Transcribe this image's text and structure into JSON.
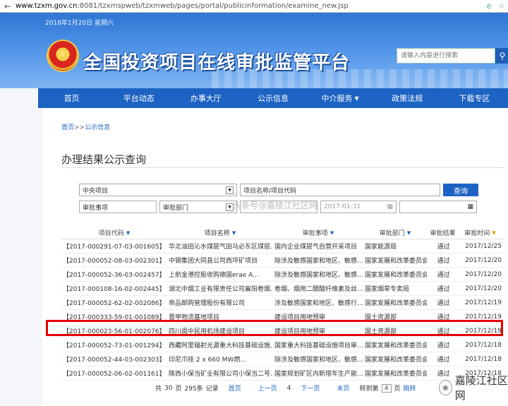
{
  "browser": {
    "url_host": "www.tzxm.gov.cn",
    "url_rest": ":8081/tzxmspweb/tzxmweb/pages/portal/publicinformation/examine_new.jsp"
  },
  "header": {
    "date": "2018年1月20日 星期六",
    "title": "全国投资项目在线审批监管平台",
    "search_placeholder": "请输入内容进行搜索"
  },
  "nav": {
    "items": [
      {
        "label": "首页"
      },
      {
        "label": "平台动态"
      },
      {
        "label": "办事大厅"
      },
      {
        "label": "公示信息"
      },
      {
        "label": "中介服务",
        "caret": "▼"
      },
      {
        "label": "政策法规"
      },
      {
        "label": "下载专区"
      }
    ]
  },
  "breadcrumb": {
    "home": "首页",
    "sep": ">>",
    "current": "公示信息"
  },
  "section": {
    "title": "办理结果公示查询"
  },
  "filters": {
    "dept_select": "中央项目",
    "project_input": "项目名称/项目代码",
    "query_label": "查询",
    "matter_select": "审批事项",
    "dept2_select": "审批部门",
    "date_start": "",
    "date_end": "2017-01-31",
    "date_end2": ""
  },
  "watermark": "头条号@嘉陵江社区网",
  "table": {
    "headers": [
      "项目代码",
      "项目名称",
      "审批事项",
      "审批部门",
      "审批结果",
      "审批时间"
    ],
    "rows": [
      [
        "【2017-000291-07-03-001605】",
        "华北油田沁水煤层气田马必东区煤层...",
        "国内企业煤层气自营开采项目",
        "国家能源局",
        "通过",
        "2017/12/25"
      ],
      [
        "【2017-000052-08-03-002301】",
        "中钢集团大同县公司西坪矿项目",
        "除涉及敏感国家和地区、敏感...",
        "国家发展和改革委员会",
        "通过",
        "2017/12/20"
      ],
      [
        "【2017-000052-36-03-002457】",
        "上航金港控股收购德国erae A...",
        "除涉及敏感国家和地区、敏感...",
        "国家发展和改革委员会",
        "通过",
        "2017/12/20"
      ],
      [
        "【2017-000108-16-02-002445】",
        "湖北中烟工业有限责任公司襄阳卷烟...",
        "卷烟、烟用二醋酸纤维素及丝...",
        "国家烟草专卖局",
        "通过",
        "2017/12/20"
      ],
      [
        "【2017-000052-62-02-002086】",
        "帝品邮购管理股份有限公司",
        "涉及敏感国家和地区、敏感行...",
        "国家发展和改革委员会",
        "通过",
        "2017/12/19"
      ],
      [
        "【2017-000333-59-01-001089】",
        "晋甲物流基地项目",
        "建设项目用地预审",
        "国土资源部",
        "通过",
        "2017/12/19"
      ],
      [
        "【2017-000023-56-01-002076】",
        "四川阆中民用机场建设项目",
        "建设项目用地预审",
        "国土资源部",
        "通过",
        "2017/12/19"
      ],
      [
        "【2017-000052-73-01-001294】",
        "西藏阿里辐射光源重大科技基础设施...",
        "国家重大科技基础设施项目审...",
        "国家发展和改革委员会",
        "通过",
        "2017/12/18"
      ],
      [
        "【2017-000052-44-03-002303】",
        "印尼爪哇 2 x 660 MW燃...",
        "除涉及敏感国家和地区、敏感...",
        "国家发展和改革委员会",
        "通过",
        "2017/12/18"
      ],
      [
        "【2017-000052-06-02-001161】",
        "陕西小保当矿业有限公司小保当二号...",
        "国家规划矿区内新增年生产能...",
        "国家发展和改革委员会",
        "通过",
        "2017/12/18"
      ]
    ]
  },
  "pager": {
    "total_prefix": "共",
    "total_pages": "30",
    "pages_label": "页",
    "total_records": "295条",
    "records_label": "记录",
    "first": "首页",
    "prev": "上一页",
    "current": "4",
    "next": "下一页",
    "last": "末页",
    "goto_prefix": "转到第",
    "goto_value": "4",
    "goto_suffix": "页",
    "goto_button": "跳转"
  },
  "brand": {
    "name": "嘉陵江社区网"
  }
}
